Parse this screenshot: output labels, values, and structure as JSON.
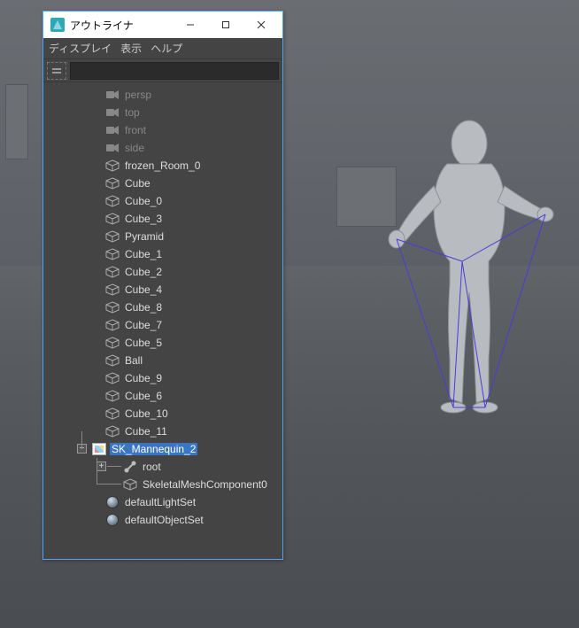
{
  "window": {
    "title": "アウトライナ"
  },
  "menu": {
    "display": "ディスプレイ",
    "show": "表示",
    "help": "ヘルプ"
  },
  "search": {
    "placeholder": ""
  },
  "tree": {
    "cameras": [
      {
        "name": "persp"
      },
      {
        "name": "top"
      },
      {
        "name": "front"
      },
      {
        "name": "side"
      }
    ],
    "meshes": [
      {
        "name": "frozen_Room_0"
      },
      {
        "name": "Cube"
      },
      {
        "name": "Cube_0"
      },
      {
        "name": "Cube_3"
      },
      {
        "name": "Pyramid"
      },
      {
        "name": "Cube_1"
      },
      {
        "name": "Cube_2"
      },
      {
        "name": "Cube_4"
      },
      {
        "name": "Cube_8"
      },
      {
        "name": "Cube_7"
      },
      {
        "name": "Cube_5"
      },
      {
        "name": "Ball"
      },
      {
        "name": "Cube_9"
      },
      {
        "name": "Cube_6"
      },
      {
        "name": "Cube_10"
      },
      {
        "name": "Cube_11"
      }
    ],
    "skeletal": {
      "name": "SK_Mannequin_2",
      "root": "root",
      "component": "SkeletalMeshComponent0"
    },
    "sets": {
      "lightSet": "defaultLightSet",
      "objectSet": "defaultObjectSet"
    },
    "toggles": {
      "minus": "−",
      "plus": "+"
    }
  }
}
